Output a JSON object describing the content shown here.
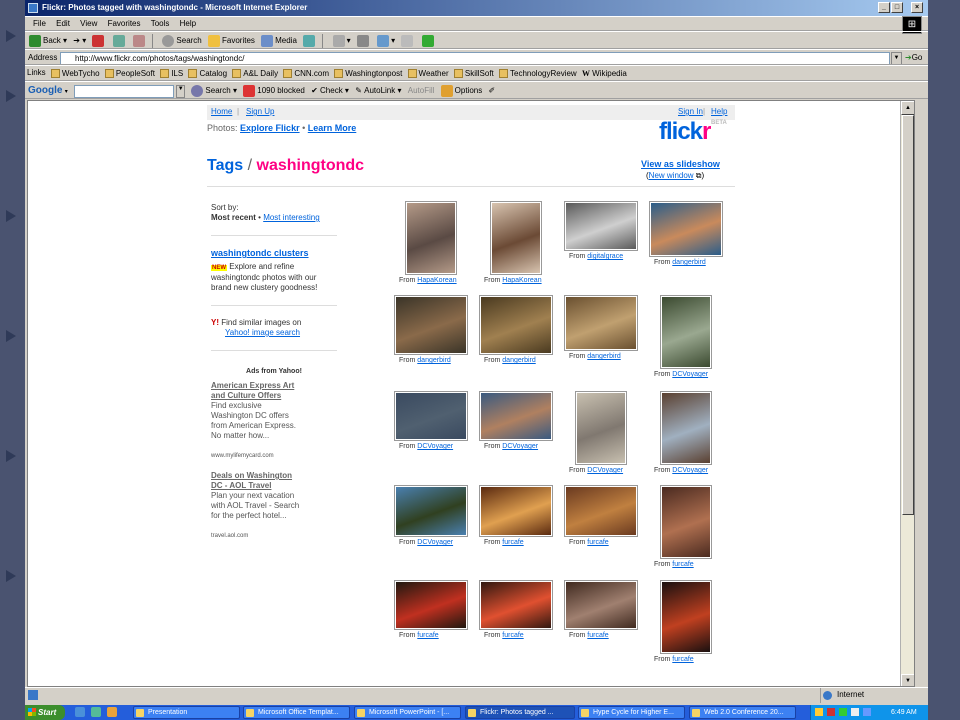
{
  "window": {
    "title": "Flickr: Photos tagged with washingtondc - Microsoft Internet Explorer",
    "controls": [
      "_",
      "□",
      "×"
    ]
  },
  "menu": [
    "File",
    "Edit",
    "View",
    "Favorites",
    "Tools",
    "Help"
  ],
  "toolbar": {
    "back": "Back",
    "search": "Search",
    "favorites": "Favorites",
    "media": "Media"
  },
  "address": {
    "label": "Address",
    "url": "http://www.flickr.com/photos/tags/washingtondc/",
    "go": "Go"
  },
  "links": {
    "label": "Links",
    "items": [
      "WebTycho",
      "PeopleSoft",
      "ILS",
      "Catalog",
      "A&L Daily",
      "CNN.com",
      "Washingtonpost",
      "Weather",
      "SkillSoft",
      "TechnologyReview",
      "Wikipedia"
    ]
  },
  "google": {
    "logo": "Google",
    "search": "Search",
    "blocked": "1090 blocked",
    "check": "Check",
    "autolink": "AutoLink",
    "autofill": "AutoFill",
    "options": "Options"
  },
  "flickr": {
    "nav": {
      "home": "Home",
      "signup": "Sign Up",
      "signin": "Sign In",
      "help": "Help",
      "sep": "|"
    },
    "photos_label": "Photos:",
    "explore": "Explore Flickr",
    "learn": "Learn More",
    "bullet": "•",
    "logo_a": "flick",
    "logo_b": "r",
    "logo_beta": "BETA",
    "tags_word": "Tags",
    "slash": " / ",
    "tag": "washingtondc",
    "slideshow": "View as slideshow",
    "new_window": "New window",
    "sort_by": "Sort by:",
    "most_recent": "Most recent",
    "most_interesting": "Most interesting",
    "clusters_title": "washingtondc clusters",
    "new_badge": "NEW",
    "clusters_text": "Explore and refine washingtondc photos with our brand new clustery goodness!",
    "find_similar": "Find similar images on",
    "yahoo_search": "Yahoo! image search",
    "ads_title": "Ads from Yahoo!",
    "ad1_title": "American Express Art and Culture Offers",
    "ad1_text": "Find exclusive Washington DC offers from American Express. No matter how...",
    "ad1_url": "www.mylifemycard.com",
    "ad2_title": "Deals on Washington DC - AOL Travel",
    "ad2_text": "Plan your next vacation with AOL Travel - Search for the perfect hotel...",
    "ad2_url": "travel.aol.com",
    "from_word": "From",
    "photos": [
      {
        "user": "HapaKorean"
      },
      {
        "user": "HapaKorean"
      },
      {
        "user": "digitalgrace"
      },
      {
        "user": "dangerbird"
      },
      {
        "user": "dangerbird"
      },
      {
        "user": "dangerbird"
      },
      {
        "user": "dangerbird"
      },
      {
        "user": "DCVoyager"
      },
      {
        "user": "DCVoyager"
      },
      {
        "user": "DCVoyager"
      },
      {
        "user": "DCVoyager"
      },
      {
        "user": "DCVoyager"
      },
      {
        "user": "DCVoyager"
      },
      {
        "user": "furcafe"
      },
      {
        "user": "furcafe"
      },
      {
        "user": "furcafe"
      },
      {
        "user": "furcafe"
      },
      {
        "user": "furcafe"
      },
      {
        "user": "furcafe"
      },
      {
        "user": "furcafe"
      }
    ]
  },
  "status": {
    "zone": "Internet"
  },
  "taskbar": {
    "start": "Start",
    "tasks": [
      "Presentation",
      "Microsoft Office Templat...",
      "Microsoft PowerPoint - [...",
      "Flickr: Photos tagged ...",
      "Hype Cycle for Higher E...",
      "Web 2.0 Conference 20..."
    ],
    "clock": "6:49 AM"
  }
}
